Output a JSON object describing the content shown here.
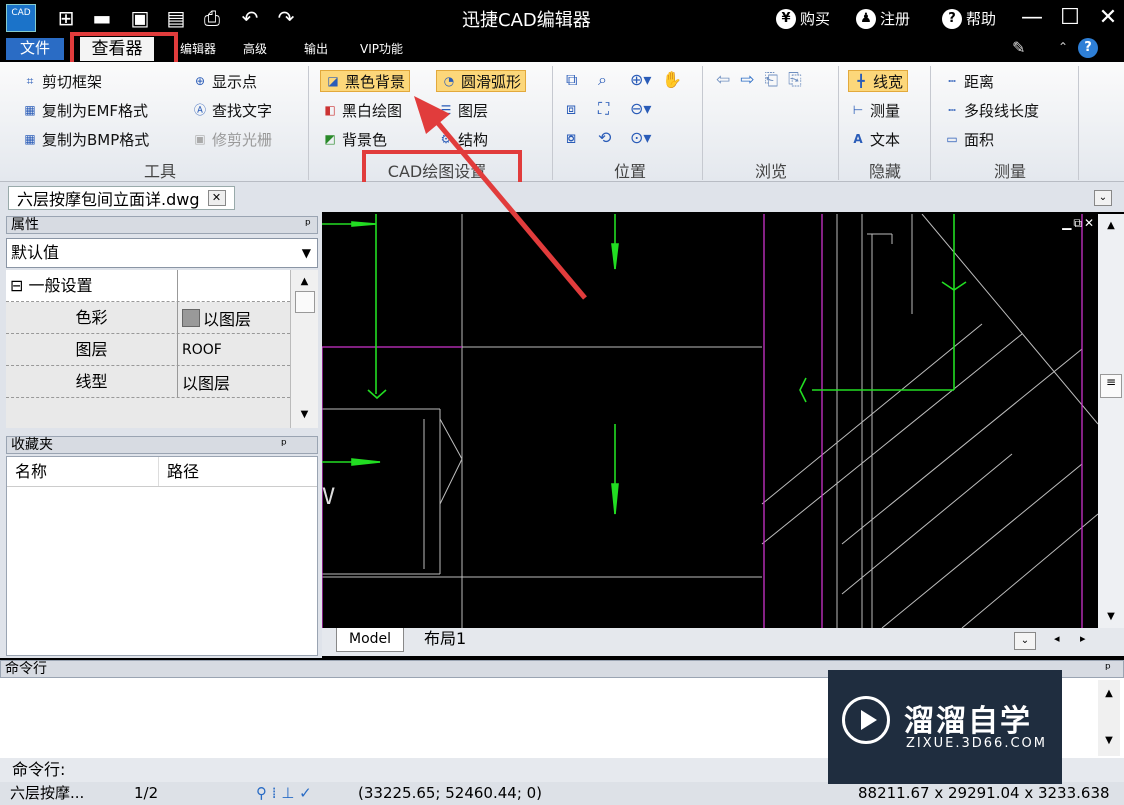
{
  "app": {
    "title": "迅捷CAD编辑器",
    "icon_label": "CAD",
    "right_buttons": [
      "购买",
      "注册",
      "帮助"
    ],
    "right_icons": [
      "yen-icon",
      "user-icon",
      "help-icon"
    ]
  },
  "menu": {
    "items": [
      "文件",
      "查看器",
      "编辑器",
      "高级",
      "输出",
      "VIP功能"
    ]
  },
  "ribbon": {
    "tools": {
      "label": "工具",
      "items": [
        "剪切框架",
        "复制为EMF格式",
        "复制为BMP格式",
        "显示点",
        "查找文字",
        "修剪光栅"
      ]
    },
    "cad_settings": {
      "label": "CAD绘图设置",
      "items": [
        "黑色背景",
        "黑白绘图",
        "背景色",
        "圆滑弧形",
        "图层",
        "结构"
      ]
    },
    "position": {
      "label": "位置"
    },
    "browse": {
      "label": "浏览"
    },
    "hide": {
      "label": "隐藏",
      "items": [
        "线宽",
        "测量",
        "文本"
      ]
    },
    "measure": {
      "label": "测量",
      "items": [
        "距离",
        "多段线长度",
        "面积"
      ]
    }
  },
  "document": {
    "tab": "六层按摩包间立面详.dwg"
  },
  "properties": {
    "title": "属性",
    "pin": "ᵖ",
    "preset": "默认值",
    "section": "一般设置",
    "rows": [
      {
        "name": "色彩",
        "value": "以图层"
      },
      {
        "name": "图层",
        "value": "ROOF"
      },
      {
        "name": "线型",
        "value": "以图层"
      }
    ]
  },
  "favorites": {
    "title": "收藏夹",
    "cols": [
      "名称",
      "路径"
    ]
  },
  "layout_tabs": [
    "Model",
    "布局1"
  ],
  "command": {
    "title": "命令行",
    "prompt": "命令行:"
  },
  "status": {
    "file": "六层按摩...",
    "page": "1/2",
    "coords": "(33225.65; 52460.44; 0)",
    "extent": "88211.67 x 29291.04 x 3233.638"
  },
  "watermark": {
    "brand": "溜溜自学",
    "url": "ZIXUE.3D66.COM"
  },
  "colors": {
    "highlight": "#e13c3c",
    "menu_active": "#2a6cc5",
    "cad_green": "#22dd22",
    "cad_magenta": "#cc33cc"
  }
}
